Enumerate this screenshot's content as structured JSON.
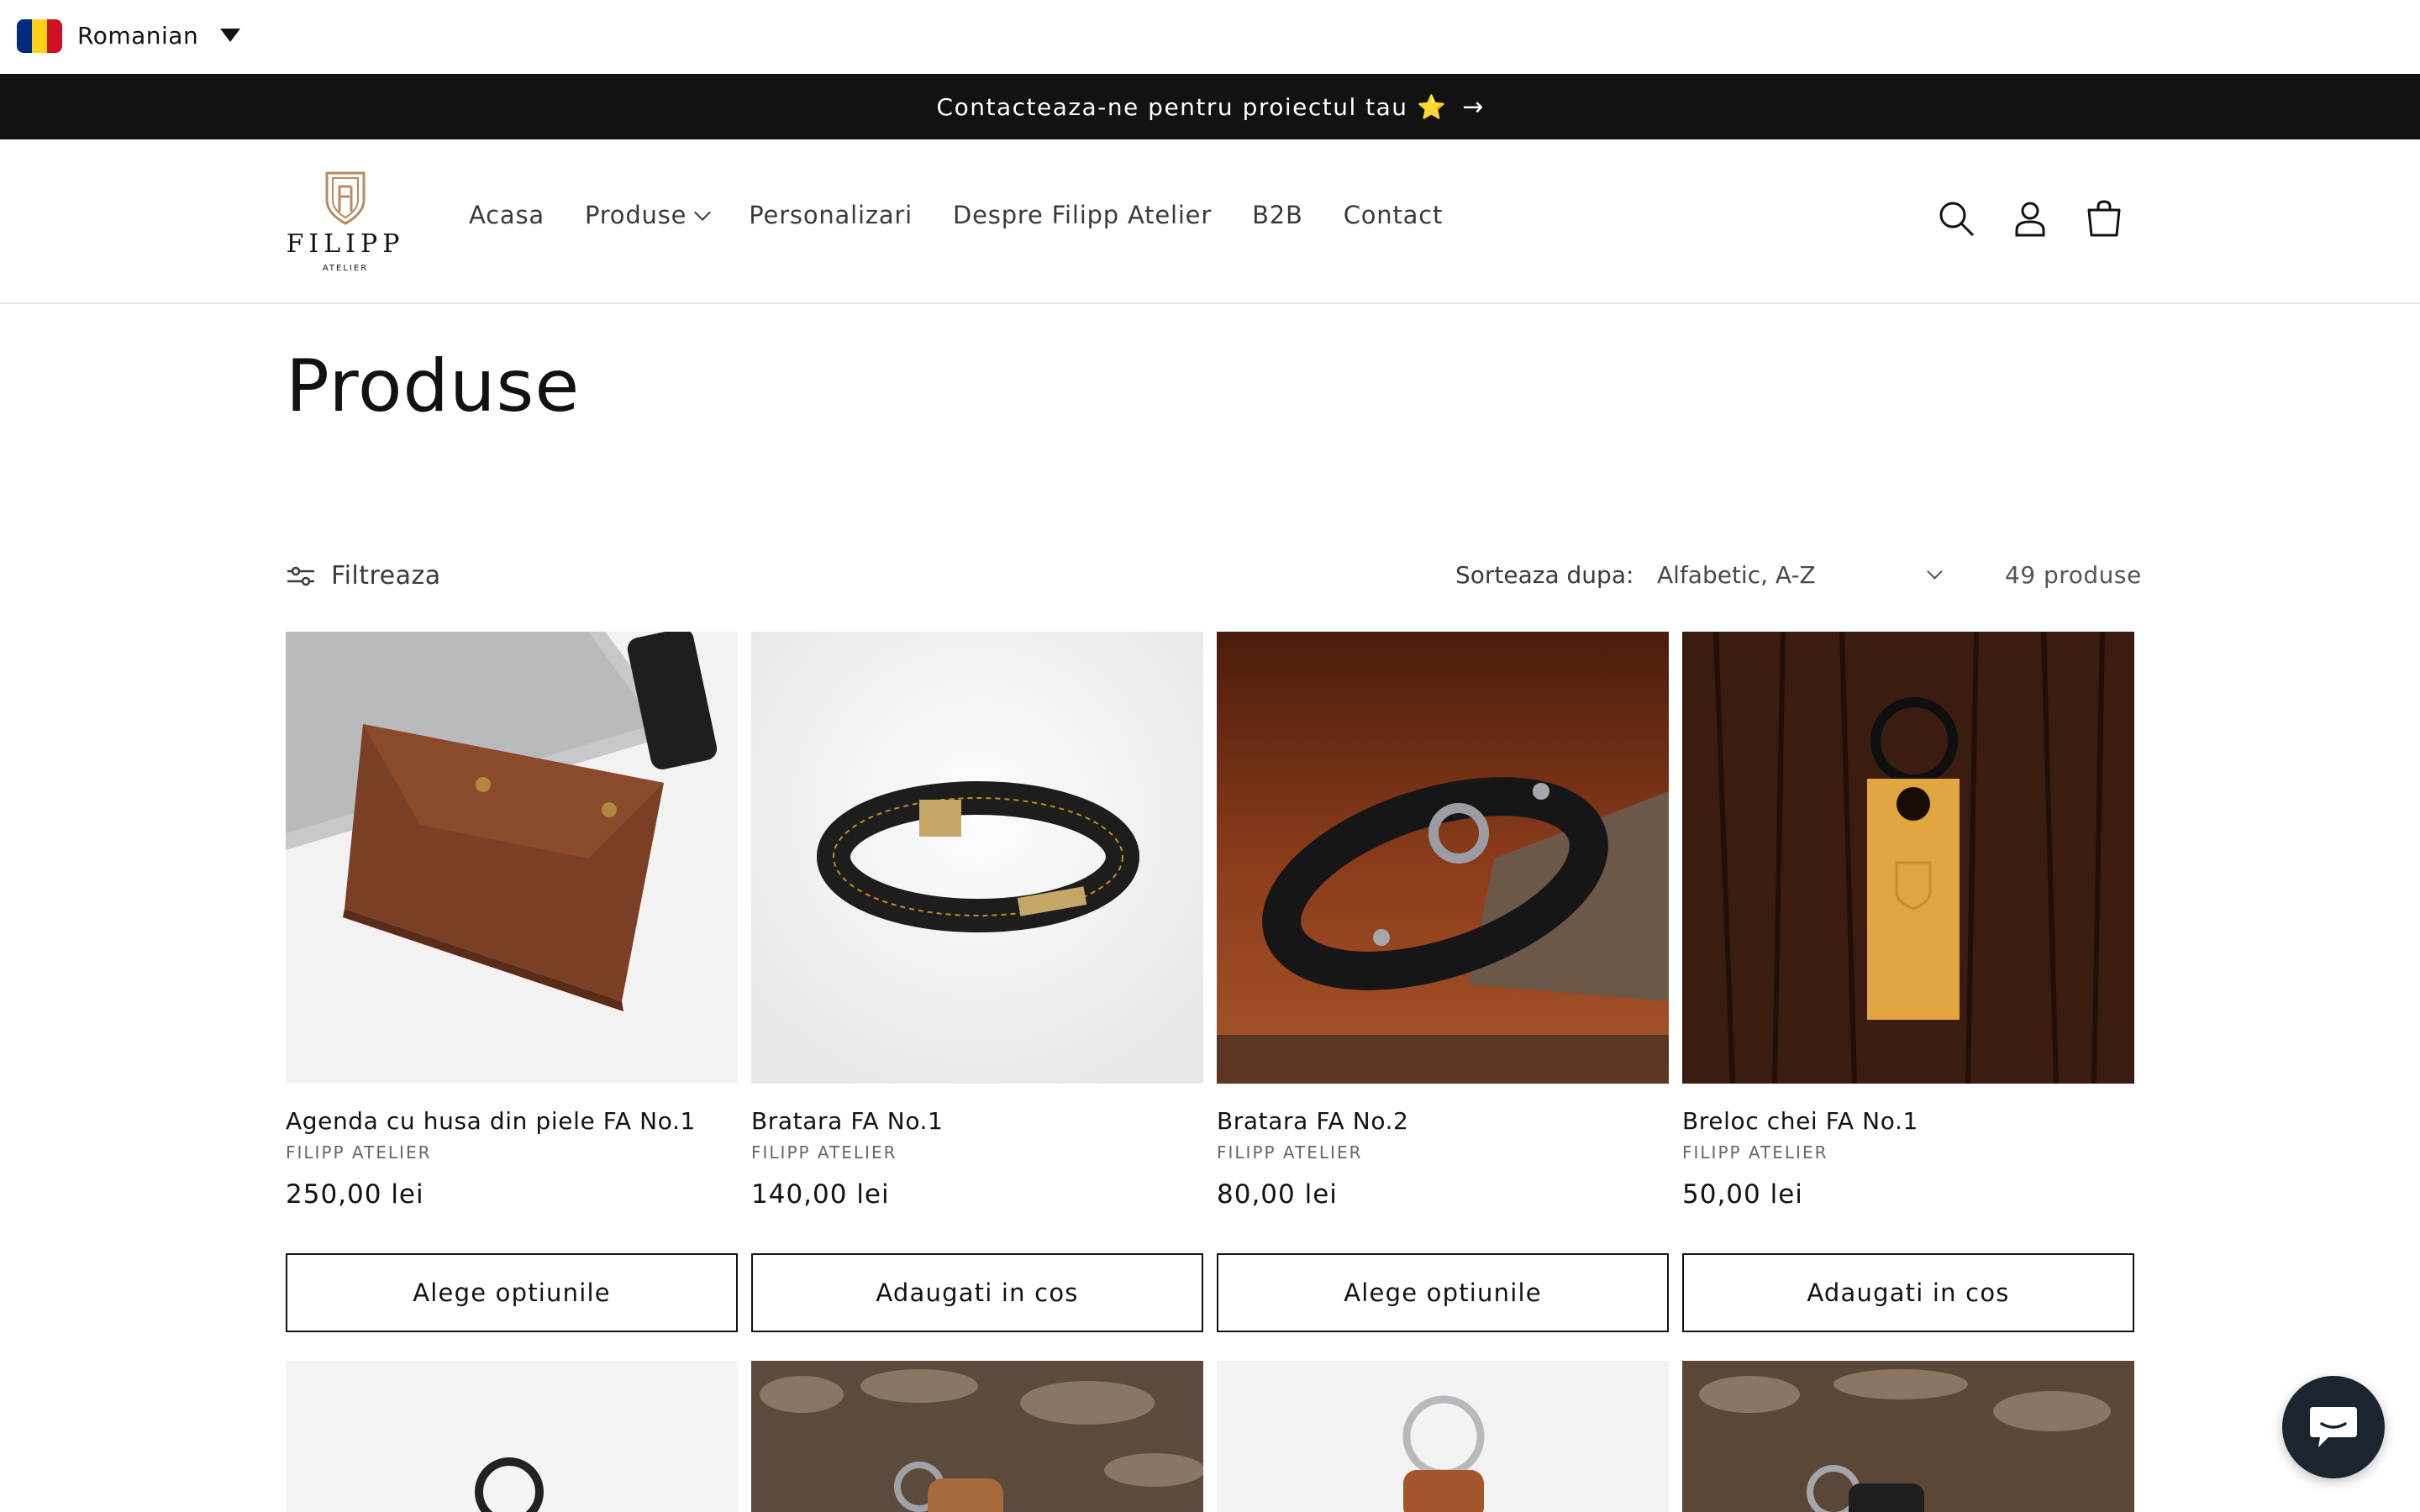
{
  "language": {
    "label": "Romanian"
  },
  "announcement": {
    "text": "Contacteaza-ne pentru proiectul tau ⭐"
  },
  "logo": {
    "name": "FILIPP",
    "sub": "ATELIER"
  },
  "nav": [
    {
      "label": "Acasa"
    },
    {
      "label": "Produse",
      "has_dropdown": true
    },
    {
      "label": "Personalizari"
    },
    {
      "label": "Despre Filipp Atelier"
    },
    {
      "label": "B2B"
    },
    {
      "label": "Contact"
    }
  ],
  "page": {
    "title": "Produse"
  },
  "toolbar": {
    "filter_label": "Filtreaza",
    "sort_label": "Sorteaza dupa:",
    "sort_value": "Alfabetic, A-Z",
    "count": "49 produse"
  },
  "products": [
    {
      "title": "Agenda cu husa din piele FA No.1",
      "vendor": "FILIPP ATELIER",
      "price": "250,00 lei",
      "button": "Alege optiunile"
    },
    {
      "title": "Bratara FA No.1",
      "vendor": "FILIPP ATELIER",
      "price": "140,00 lei",
      "button": "Adaugati in cos"
    },
    {
      "title": "Bratara FA No.2",
      "vendor": "FILIPP ATELIER",
      "price": "80,00 lei",
      "button": "Alege optiunile"
    },
    {
      "title": "Breloc chei FA No.1",
      "vendor": "FILIPP ATELIER",
      "price": "50,00 lei",
      "button": "Adaugati in cos"
    }
  ],
  "icons": [
    "search-icon",
    "account-icon",
    "cart-icon",
    "filter-icon",
    "chat-icon",
    "arrow-right-icon",
    "chevron-down-icon"
  ],
  "colors": {
    "bar": "#121212",
    "text": "#121212",
    "logo": "#b98a5e",
    "chat": "#1a2530"
  }
}
